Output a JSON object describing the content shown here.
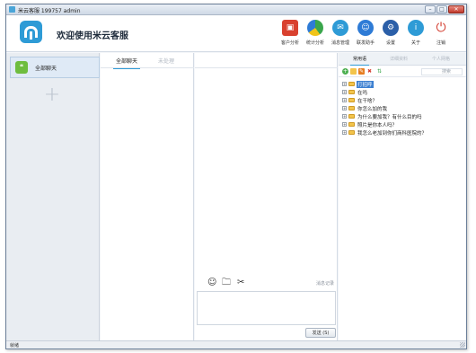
{
  "window": {
    "title": "米云客服  199757  admin",
    "controls": {
      "minimize": "–",
      "maximize": "□",
      "close": "✕"
    }
  },
  "header": {
    "logo_icon": "mi-logo-icon",
    "welcome": "欢迎使用米云客服"
  },
  "toolbar": {
    "items": [
      {
        "label": "客户分析",
        "icon": "customer-analysis-icon",
        "color": "#d9412f"
      },
      {
        "label": "统计分析",
        "icon": "pie-chart-icon",
        "color": "#3aa64c"
      },
      {
        "label": "消息管理",
        "icon": "message-bubble-icon",
        "color": "#2e9bd6"
      },
      {
        "label": "联发助手",
        "icon": "people-icon",
        "color": "#2e7bd6"
      },
      {
        "label": "设置",
        "icon": "gear-icon",
        "color": "#2b5fa8"
      },
      {
        "label": "关于",
        "icon": "info-icon",
        "color": "#2e9bd6"
      },
      {
        "label": "注销",
        "icon": "power-icon",
        "color": "#d33a2c"
      }
    ]
  },
  "nav": {
    "chat_item": "全部聊天",
    "add_symbol": "+"
  },
  "conversations": {
    "tab_all": "全部聊天",
    "tab_unread": "未处理"
  },
  "chat": {
    "tools": {
      "emoji": "☺",
      "folder": "🗀",
      "scissors": "✂"
    },
    "history_link": "消息记录",
    "input_value": "",
    "send_label": "发送 (S)"
  },
  "right_panel": {
    "tabs": [
      "常用语",
      "详细资料",
      "个人网格"
    ],
    "search_placeholder": "搜索",
    "phrases": [
      "打招呼",
      "在吗",
      "在干啥？",
      "你怎么加的我",
      "为什么要加我？有什么目的吗",
      "照片是你本人吗？",
      "我怎么老加到你们商科医院的？"
    ],
    "selected_index": 0
  },
  "status": {
    "text": "就绪"
  }
}
